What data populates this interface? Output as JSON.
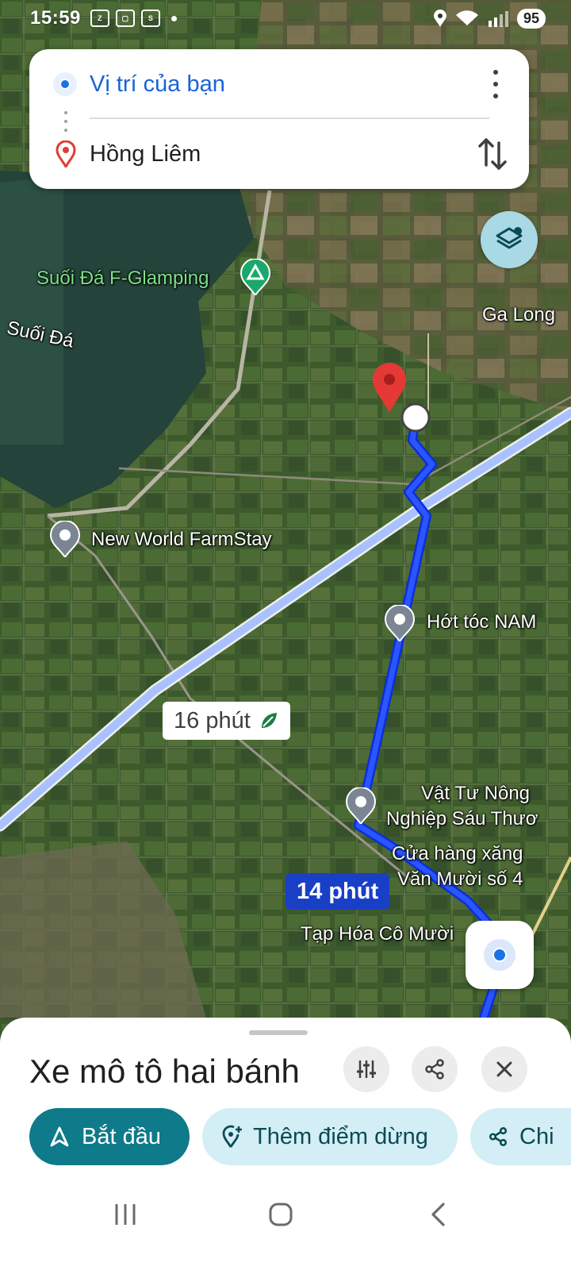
{
  "status_bar": {
    "time": "15:59",
    "notification_icons": [
      "zalo-icon",
      "scan-icon",
      "shopee-icon"
    ],
    "battery": "95"
  },
  "route": {
    "origin": "Vị trí của bạn",
    "destination": "Hồng Liêm"
  },
  "map": {
    "labels": {
      "glamping": "Suối Đá F-Glamping",
      "suoi_da": "Suối Đá",
      "ga_long": "Ga Long",
      "farmstay": "New World FarmStay",
      "hot_toc": "Hớt tóc NAM",
      "vat_tu_1": "Vật Tư Nông",
      "vat_tu_2": "Nghiệp Sáu Thươ",
      "cua_hang_1": "Cửa hàng xăng",
      "cua_hang_2": "Văn Mười số 4",
      "tap_hoa": "Tạp Hóa Cô Mười"
    },
    "alt_route_duration": "16 phút",
    "main_route_duration": "14 phút",
    "colors": {
      "route": "#1a3ff0",
      "alt_route": "#a9c1ff",
      "dest_pin": "#e53935"
    }
  },
  "sheet": {
    "title": "Xe mô tô hai bánh",
    "chips": {
      "start": "Bắt đầu",
      "add_stop": "Thêm điểm dừng",
      "share": "Chi"
    }
  }
}
